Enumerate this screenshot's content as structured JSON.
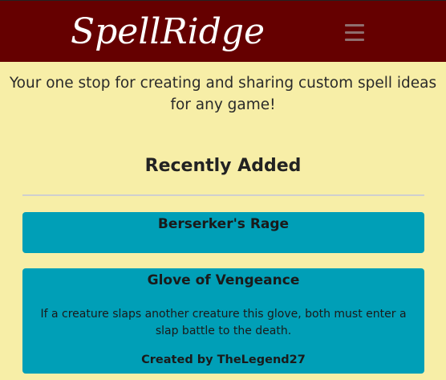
{
  "navbar": {
    "brand": "SpellRidge",
    "menu_icon": "hamburger-menu-icon",
    "background_color": "#650000"
  },
  "tagline": "Your one stop for creating and sharing custom spell ideas for any game!",
  "recent": {
    "heading": "Recently Added",
    "cards": [
      {
        "title": "Berserker's Rage",
        "description": "",
        "author": ""
      },
      {
        "title": "Glove of Vengeance",
        "description": "If a creature slaps another creature this glove, both must enter a slap battle to the death.",
        "author": "Created by TheLegend27"
      }
    ]
  },
  "colors": {
    "page_background": "#f7eea7",
    "card_background": "#009fb7"
  }
}
